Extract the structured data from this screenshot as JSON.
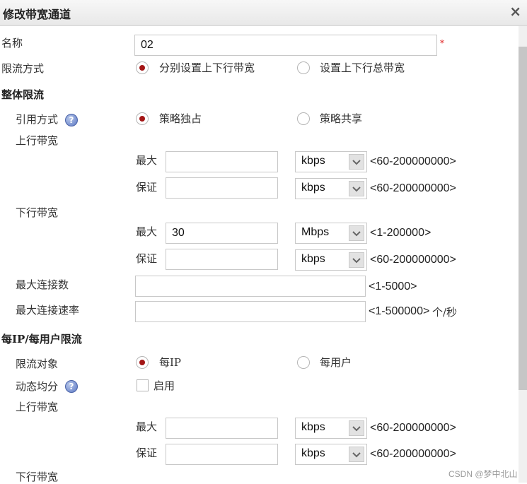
{
  "dialog": {
    "title": "修改带宽通道",
    "close_symbol": "×"
  },
  "form": {
    "name": {
      "label": "名称",
      "value": "02",
      "required_mark": "*"
    },
    "limit_mode": {
      "label": "限流方式",
      "options": [
        {
          "label": "分别设置上下行带宽",
          "checked": true
        },
        {
          "label": "设置上下行总带宽",
          "checked": false
        }
      ]
    },
    "overall": {
      "heading": "整体限流",
      "reference": {
        "label": "引用方式",
        "help": "?",
        "options": [
          {
            "label": "策略独占",
            "checked": true
          },
          {
            "label": "策略共享",
            "checked": false
          }
        ]
      },
      "upstream": {
        "label": "上行带宽",
        "max": {
          "label": "最大",
          "value": "",
          "unit": "kbps",
          "range": "<60-200000000>"
        },
        "guarantee": {
          "label": "保证",
          "value": "",
          "unit": "kbps",
          "range": "<60-200000000>"
        }
      },
      "downstream": {
        "label": "下行带宽",
        "max": {
          "label": "最大",
          "value": "30",
          "unit": "Mbps",
          "range": "<1-200000>"
        },
        "guarantee": {
          "label": "保证",
          "value": "",
          "unit": "kbps",
          "range": "<60-200000000>"
        }
      },
      "max_connections": {
        "label": "最大连接数",
        "value": "",
        "range": "<1-5000>"
      },
      "max_connection_rate": {
        "label": "最大连接速率",
        "value": "",
        "range": "<1-500000>",
        "unit": "个/秒"
      }
    },
    "per_ip": {
      "heading": "每IP/每用户限流",
      "target": {
        "label": "限流对象",
        "options": [
          {
            "label": "每IP",
            "checked": true
          },
          {
            "label": "每用户",
            "checked": false
          }
        ]
      },
      "dynamic_balance": {
        "label": "动态均分",
        "help": "?",
        "checkbox_label": "启用",
        "checked": false
      },
      "upstream": {
        "label": "上行带宽",
        "max": {
          "label": "最大",
          "value": "",
          "unit": "kbps",
          "range": "<60-200000000>"
        },
        "guarantee": {
          "label": "保证",
          "value": "",
          "unit": "kbps",
          "range": "<60-200000000>"
        }
      },
      "downstream": {
        "label": "下行带宽"
      }
    }
  },
  "watermark": "CSDN @梦中北山",
  "colors": {
    "radio_selected": "#a31515",
    "required": "#e02020",
    "help_icon": "#5c78c4"
  },
  "icons": {
    "close": "close-icon",
    "help": "help-icon",
    "dropdown": "chevron-down-icon"
  }
}
